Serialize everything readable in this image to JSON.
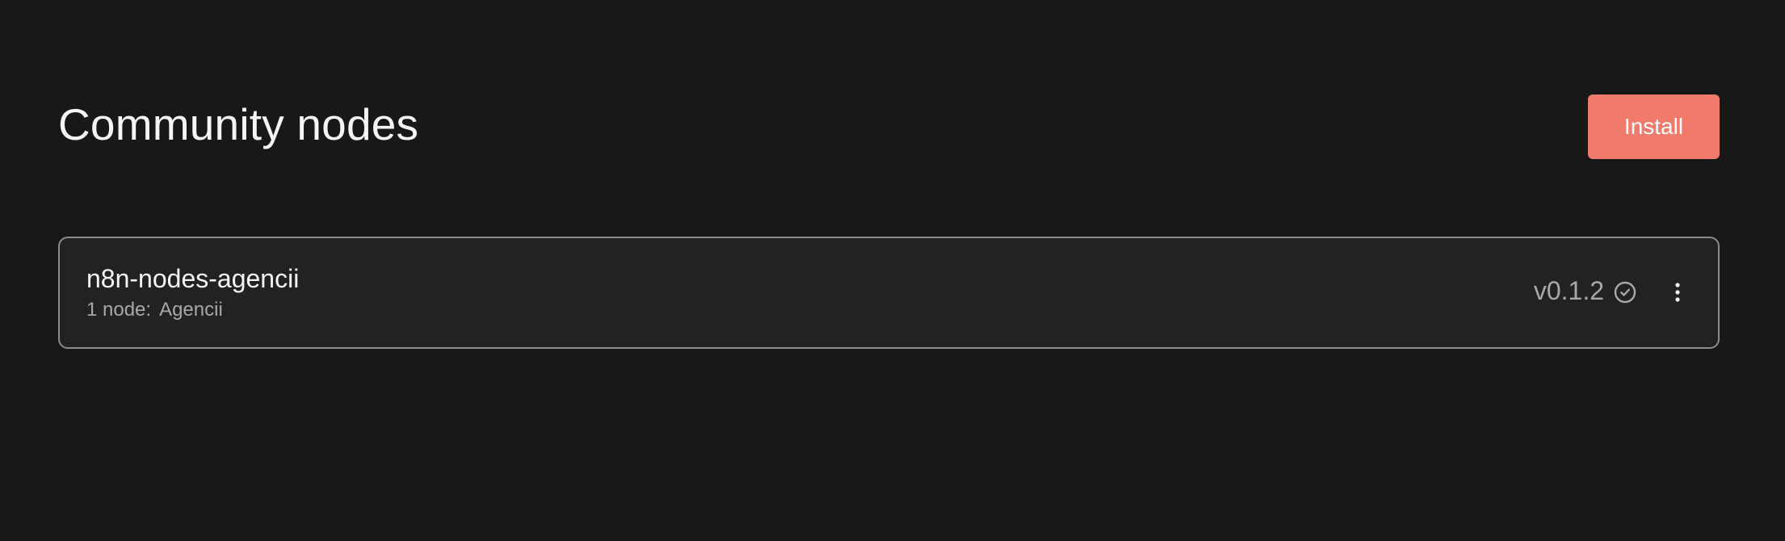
{
  "page": {
    "title": "Community nodes"
  },
  "actions": {
    "install_label": "Install"
  },
  "packages": [
    {
      "name": "n8n-nodes-agencii",
      "node_count_label": "1 node:",
      "node_names": "Agencii",
      "version": "v0.1.2",
      "status_icon": "check-circle-icon",
      "menu_icon": "more-vertical-icon"
    }
  ],
  "colors": {
    "background": "#181818",
    "card_background": "#222222",
    "card_border": "#8c8c8c",
    "accent": "#f07b6c",
    "primary_text": "#f5f5f5",
    "secondary_text": "#a8a8a8"
  }
}
